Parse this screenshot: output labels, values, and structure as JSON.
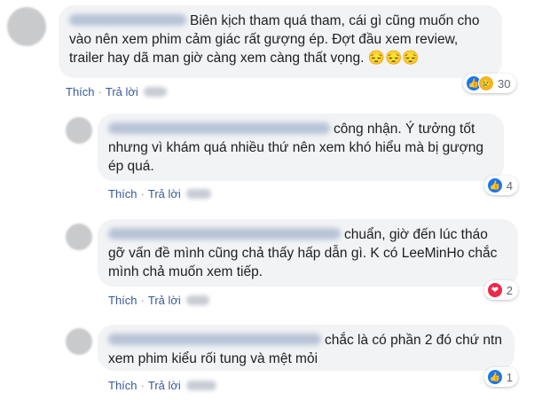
{
  "comments": [
    {
      "text": "Biên kịch tham quá tham, cái gì cũng muốn cho vào nên xem phim cảm giác rất gượng ép. Đợt đầu xem review, trailer hay dã man giờ càng xem càng thất vọng. 😔😔😔",
      "like_label": "Thích",
      "reply_label": "Trả lời",
      "reaction_icons": [
        "like-icon",
        "sad-icon"
      ],
      "reaction_count": "30"
    },
    {
      "text": "công nhận. Ý tưởng tốt nhưng vì khám quá nhiều thứ nên xem khó hiểu mà bị gượng ép quá.",
      "like_label": "Thích",
      "reply_label": "Trả lời",
      "reaction_icons": [
        "like-icon"
      ],
      "reaction_count": "4"
    },
    {
      "text": "chuẩn, giờ đến lúc tháo gỡ vấn đề mình cũng chả thấy hấp dẫn gì. K có LeeMinHo chắc mình chả muốn xem tiếp.",
      "like_label": "Thích",
      "reply_label": "Trả lời",
      "reaction_icons": [
        "heart-icon"
      ],
      "reaction_count": "2"
    },
    {
      "text": "chắc là có phần 2 đó chứ ntn xem phim kiểu rối tung và mệt mỏi",
      "like_label": "Thích",
      "reply_label": "Trả lời",
      "reaction_icons": [
        "like-icon"
      ],
      "reaction_count": "1"
    }
  ],
  "colors": {
    "link": "#385898",
    "bubble": "#f2f3f5",
    "like": "#1877f2",
    "love": "#f0284a"
  }
}
